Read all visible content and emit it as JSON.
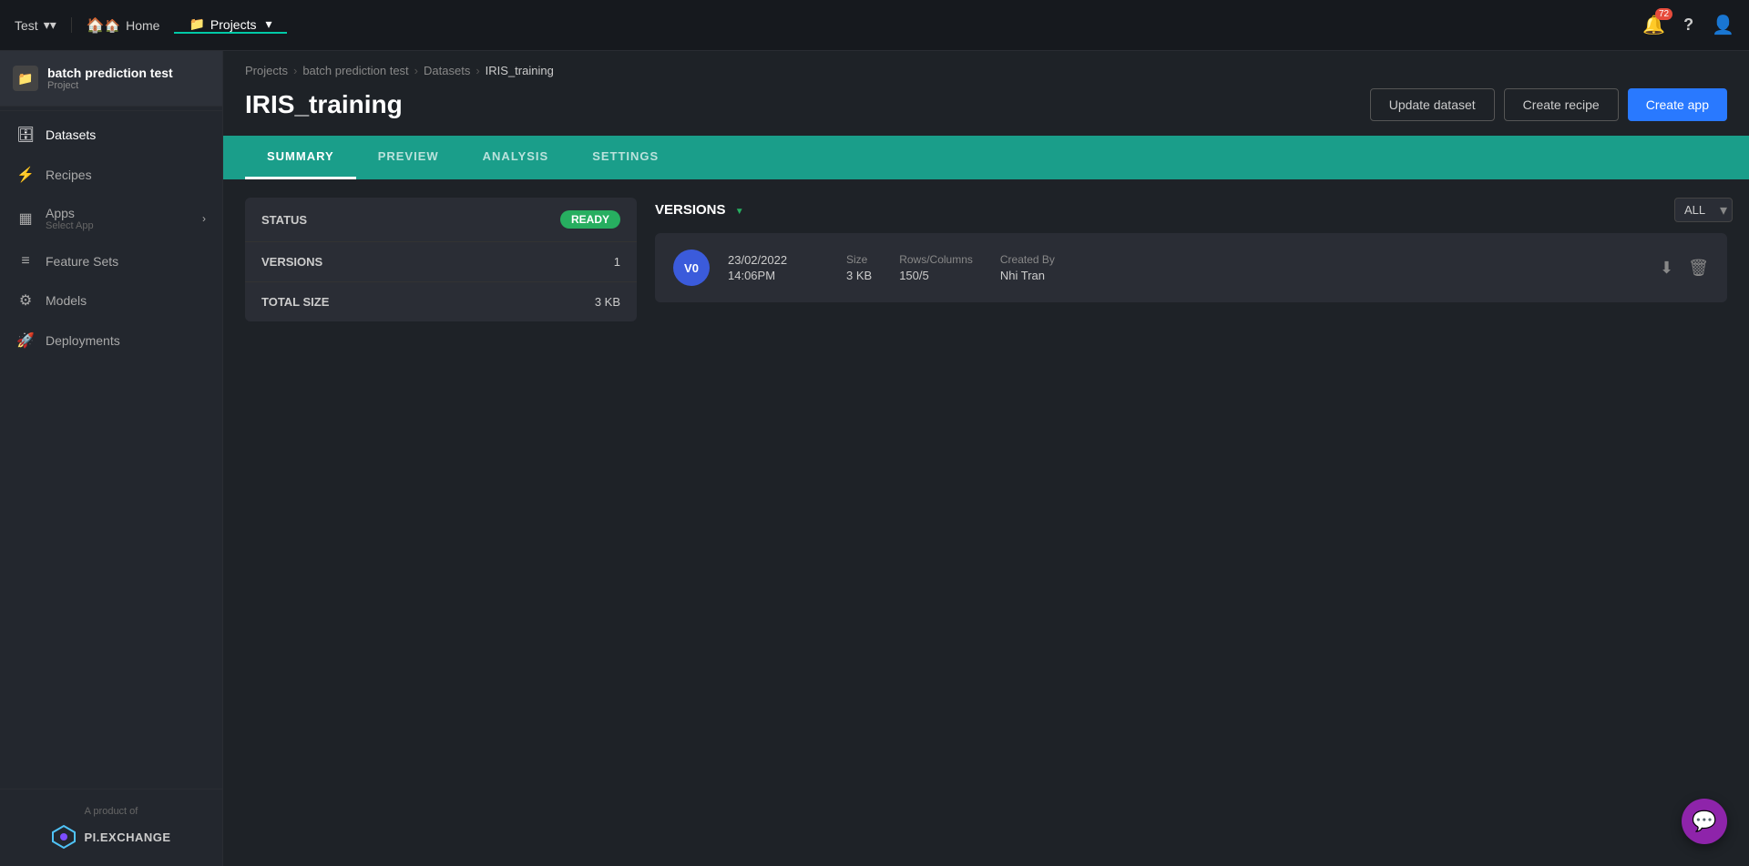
{
  "topnav": {
    "test_label": "Test",
    "home_label": "Home",
    "projects_label": "Projects",
    "notification_count": "72"
  },
  "sidebar": {
    "project_name": "batch prediction test",
    "project_sub": "Project",
    "items": [
      {
        "id": "datasets",
        "label": "Datasets",
        "icon": "db"
      },
      {
        "id": "recipes",
        "label": "Recipes",
        "icon": "recipe"
      },
      {
        "id": "apps",
        "label": "Apps",
        "icon": "apps",
        "sub": "Select App",
        "expandable": true
      },
      {
        "id": "feature-sets",
        "label": "Feature Sets",
        "icon": "featuresets"
      },
      {
        "id": "models",
        "label": "Models",
        "icon": "models"
      },
      {
        "id": "deployments",
        "label": "Deployments",
        "icon": "deploy"
      }
    ],
    "footer_text": "A product of",
    "logo_text": "PI.EXCHANGE"
  },
  "breadcrumb": {
    "items": [
      "Projects",
      "batch prediction test",
      "Datasets",
      "IRIS_training"
    ]
  },
  "page": {
    "title": "IRIS_training",
    "actions": {
      "update": "Update dataset",
      "create_recipe": "Create recipe",
      "create_app": "Create app"
    }
  },
  "tabs": [
    {
      "id": "summary",
      "label": "SUMMARY",
      "active": true
    },
    {
      "id": "preview",
      "label": "PREVIEW"
    },
    {
      "id": "analysis",
      "label": "ANALYSIS"
    },
    {
      "id": "settings",
      "label": "SETTINGS"
    }
  ],
  "summary": {
    "status_label": "STATUS",
    "status_value": "READY",
    "versions_label": "VERSIONS",
    "versions_value": "1",
    "size_label": "TOTAL SIZE",
    "size_value": "3 KB"
  },
  "versions": {
    "title": "VERSIONS",
    "filter_options": [
      "ALL"
    ],
    "filter_selected": "ALL",
    "rows": [
      {
        "badge": "V0",
        "date": "23/02/2022",
        "time": "14:06PM",
        "size_label": "Size",
        "size_value": "3 KB",
        "rows_cols_label": "Rows/Columns",
        "rows_cols_value": "150/5",
        "created_by_label": "Created By",
        "created_by_value": "Nhi Tran"
      }
    ]
  },
  "colors": {
    "teal": "#1a9e8a",
    "ready_green": "#27ae60",
    "primary_blue": "#2979ff",
    "version_badge": "#3b5bdb"
  }
}
